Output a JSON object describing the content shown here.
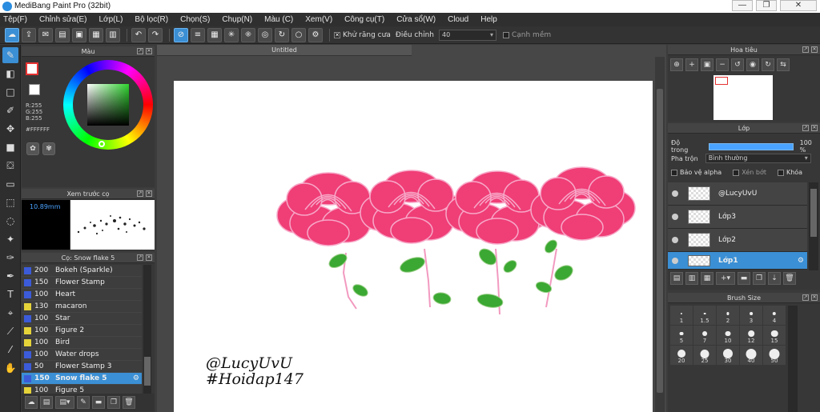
{
  "window": {
    "title": "MediBang Paint Pro (32bit)",
    "minimize": "—",
    "maximize": "❐",
    "close": "✕"
  },
  "menu": [
    "Tệp(F)",
    "Chỉnh sửa(E)",
    "Lớp(L)",
    "Bộ lọc(R)",
    "Chọn(S)",
    "Chụp(N)",
    "Màu (C)",
    "Xem(V)",
    "Công cụ(T)",
    "Cửa sổ(W)",
    "Cloud",
    "Help"
  ],
  "toolbar": {
    "antialias_label": "Khử răng cưa",
    "adjust_label": "Điều chỉnh",
    "adjust_value": "40",
    "sharp_edge_label": "Cạnh mềm"
  },
  "color_panel": {
    "title": "Màu",
    "r": "R:255",
    "g": "G:255",
    "b": "B:255",
    "hex": "#FFFFFF",
    "fg_color": "#e53232"
  },
  "preview_panel": {
    "title": "Xem trước cọ",
    "size": "10.89mm"
  },
  "brush_panel": {
    "title": "Cọ: Snow flake 5",
    "items": [
      {
        "size": "200",
        "name": "Bokeh (Sparkle)",
        "color": "#3b5bd9"
      },
      {
        "size": "150",
        "name": "Flower Stamp",
        "color": "#3b5bd9"
      },
      {
        "size": "100",
        "name": "Heart",
        "color": "#3b5bd9"
      },
      {
        "size": "130",
        "name": "macaron",
        "color": "#e5d33a"
      },
      {
        "size": "100",
        "name": "Star",
        "color": "#3b5bd9"
      },
      {
        "size": "100",
        "name": "Figure 2",
        "color": "#e5d33a"
      },
      {
        "size": "100",
        "name": "Bird",
        "color": "#e5d33a"
      },
      {
        "size": "100",
        "name": "Water drops",
        "color": "#3b5bd9"
      },
      {
        "size": "50",
        "name": "Flower Stamp 3",
        "color": "#3b5bd9"
      },
      {
        "size": "150",
        "name": "Snow flake 5",
        "color": "#3b5bd9",
        "selected": true
      },
      {
        "size": "100",
        "name": "Figure 5",
        "color": "#e5d33a"
      }
    ]
  },
  "document": {
    "tab_title": "Untitled",
    "signature_line1": "@LucyUvU",
    "signature_line2": "#Hoidap147",
    "rose_color": "#f03e77",
    "leaf_color": "#3aa832"
  },
  "navigator": {
    "title": "Hoa tiêu"
  },
  "layer_panel": {
    "title": "Lớp",
    "opacity_label": "Độ trong",
    "opacity_value": "100 %",
    "blend_label": "Pha trộn",
    "blend_value": "Bình thường",
    "protect_alpha": "Bảo vệ alpha",
    "clipping": "Xén bớt",
    "lock": "Khóa",
    "layers": [
      {
        "name": "@LucyUvU"
      },
      {
        "name": "Lớp3"
      },
      {
        "name": "Lớp2"
      },
      {
        "name": "Lớp1",
        "selected": true
      }
    ]
  },
  "size_panel": {
    "title": "Brush Size",
    "sizes": [
      "1",
      "1.5",
      "2",
      "3",
      "4",
      "5",
      "7",
      "10",
      "12",
      "15",
      "20",
      "25",
      "30",
      "40",
      "50"
    ]
  }
}
